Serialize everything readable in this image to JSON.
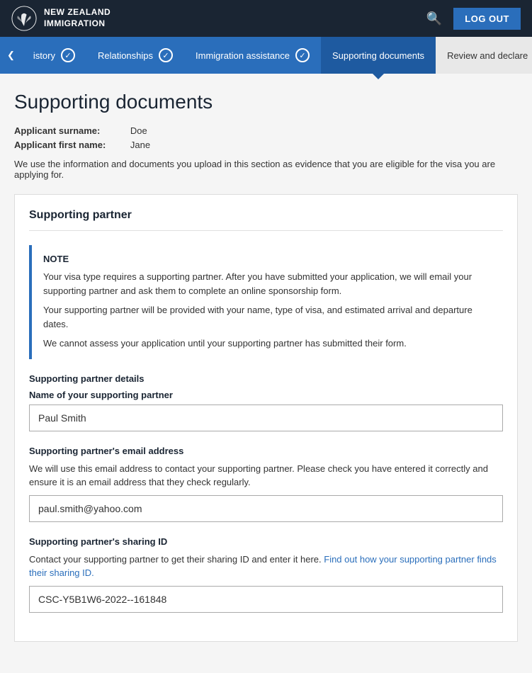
{
  "header": {
    "logo_line1": "NEW ZEALAND",
    "logo_line2": "IMMIGRATION",
    "logout_label": "LOG OUT",
    "search_icon": "🔍"
  },
  "nav": {
    "back_arrow": "❮",
    "tabs": [
      {
        "id": "history",
        "label": "istory",
        "status": "completed",
        "check": "✓"
      },
      {
        "id": "relationships",
        "label": "Relationships",
        "status": "completed",
        "check": "✓"
      },
      {
        "id": "immigration",
        "label": "Immigration assistance",
        "status": "completed",
        "check": "✓"
      },
      {
        "id": "supporting",
        "label": "Supporting documents",
        "status": "active"
      },
      {
        "id": "review",
        "label": "Review and declare",
        "status": "inactive"
      }
    ]
  },
  "page": {
    "title": "Supporting documents",
    "applicant_surname_label": "Applicant surname:",
    "applicant_surname_value": "Doe",
    "applicant_firstname_label": "Applicant first name:",
    "applicant_firstname_value": "Jane",
    "info_text": "We use the information and documents you upload in this section as evidence that you are eligible for the visa you are applying for."
  },
  "supporting_partner_card": {
    "title": "Supporting partner",
    "note": {
      "title": "NOTE",
      "para1": "Your visa type requires a supporting partner. After you have submitted your application, we will email your supporting partner and ask them to complete an online sponsorship form.",
      "para2": "Your supporting partner will be provided with your name, type of visa, and estimated arrival and departure dates.",
      "para3": "We cannot assess your application until your supporting partner has submitted their form."
    },
    "section_title": "Supporting partner details",
    "name_label": "Name of your supporting partner",
    "name_value": "Paul Smith",
    "email_section_title": "Supporting partner's email address",
    "email_desc": "We will use this email address to contact your supporting partner. Please check you have entered it correctly and ensure it is an email address that they check regularly.",
    "email_value": "paul.smith@yahoo.com",
    "sharing_id_section_title": "Supporting partner's sharing ID",
    "sharing_id_desc_before": "Contact your supporting partner to get their sharing ID and enter it here. ",
    "sharing_id_link": "Find out how your supporting partner finds their sharing ID.",
    "sharing_id_value": "CSC-Y5B1W6-2022--161848"
  }
}
